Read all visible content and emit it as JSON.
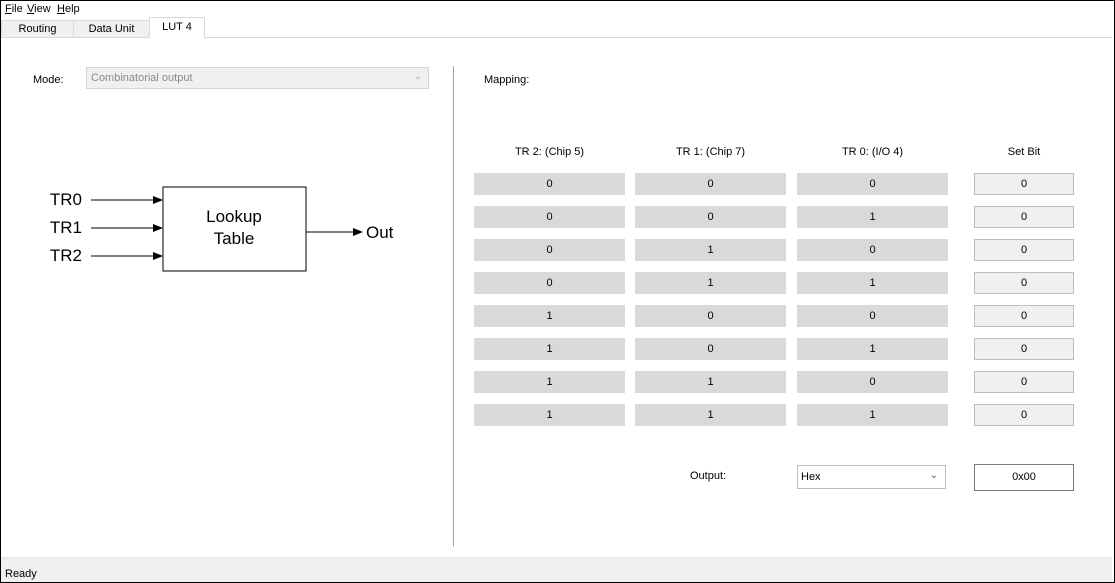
{
  "menu": {
    "file": {
      "accel": "F",
      "rest": "ile"
    },
    "view": {
      "accel": "V",
      "rest": "iew"
    },
    "help": {
      "accel": "H",
      "rest": "elp"
    }
  },
  "tabs": [
    {
      "label": "Routing"
    },
    {
      "label": "Data Unit"
    },
    {
      "label": "LUT 4"
    }
  ],
  "mode": {
    "label": "Mode:",
    "value": "Combinatorial output"
  },
  "diagram": {
    "inputs": [
      "TR0",
      "TR1",
      "TR2"
    ],
    "box_line1": "Lookup",
    "box_line2": "Table",
    "output": "Out"
  },
  "mapping": {
    "label": "Mapping:",
    "headers": [
      "TR 2:  (Chip 5)",
      "TR 1:  (Chip 7)",
      "TR 0:  (I/O 4)",
      "Set Bit"
    ],
    "rows": [
      {
        "tr2": "0",
        "tr1": "0",
        "tr0": "0",
        "set": "0"
      },
      {
        "tr2": "0",
        "tr1": "0",
        "tr0": "1",
        "set": "0"
      },
      {
        "tr2": "0",
        "tr1": "1",
        "tr0": "0",
        "set": "0"
      },
      {
        "tr2": "0",
        "tr1": "1",
        "tr0": "1",
        "set": "0"
      },
      {
        "tr2": "1",
        "tr1": "0",
        "tr0": "0",
        "set": "0"
      },
      {
        "tr2": "1",
        "tr1": "0",
        "tr0": "1",
        "set": "0"
      },
      {
        "tr2": "1",
        "tr1": "1",
        "tr0": "0",
        "set": "0"
      },
      {
        "tr2": "1",
        "tr1": "1",
        "tr0": "1",
        "set": "0"
      }
    ]
  },
  "output": {
    "label": "Output:",
    "format": "Hex",
    "value": "0x00"
  },
  "status": {
    "text": "Ready"
  },
  "icons": {
    "dropdown": "chevron-down-icon",
    "arrow": "arrow-right-icon"
  }
}
